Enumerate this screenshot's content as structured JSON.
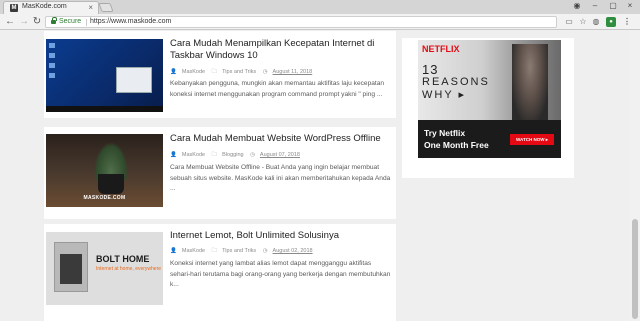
{
  "browser": {
    "tab_title": "MasKode.com",
    "tab_favicon": "M",
    "secure_label": "Secure",
    "url": "https://www.maskode.com",
    "close_glyph": "×",
    "win_min": "–",
    "win_max": "▢",
    "win_close": "×",
    "win_user": "◉",
    "back": "←",
    "forward": "→",
    "reload": "↻",
    "menu": "⋮"
  },
  "posts": [
    {
      "title": "Cara Mudah Menampilkan Kecepatan Internet di Taskbar Windows 10",
      "author": "MasKode",
      "category": "Tips and Triks",
      "date": "August 11, 2018",
      "excerpt": "Kebanyakan pengguna, mungkin akan memantau aktifitas laju kecepatan koneksi internet menggunakan program command prompt yakni \" ping ..."
    },
    {
      "title": "Cara Mudah Membuat Website WordPress Offline",
      "author": "MasKode",
      "category": "Blogging",
      "date": "August 07, 2018",
      "excerpt": "Cara Membuat Website Offline - Buat Anda yang ingin belajar membuat sebuah situs website. MasKode kali ini akan memberitahukan kepada Anda ...",
      "thumb_caption": "MASKODE.COM"
    },
    {
      "title": "Internet Lemot, Bolt Unlimited Solusinya",
      "author": "MasKode",
      "category": "Tips and Triks",
      "date": "August 02, 2018",
      "excerpt": "Koneksi internet yang lambat alias lemot dapat mengganggu aktifitas sehari-hari terutama bagi orang-orang yang berkerja dengan membutuhkan k...",
      "thumb_title": "BOLT HOME",
      "thumb_sub": "Internet at home, everywhere"
    }
  ],
  "ad": {
    "brand": "NETFLIX",
    "line1": "13",
    "line2": "REASONS",
    "line3": "WHY ▸",
    "cta_line1": "Try Netflix",
    "cta_line2": "One Month Free",
    "button": "WATCH NOW ▸"
  },
  "colors": {
    "netflix_red": "#e50914",
    "secure_green": "#2e7d32",
    "page_bg": "#efefef"
  }
}
